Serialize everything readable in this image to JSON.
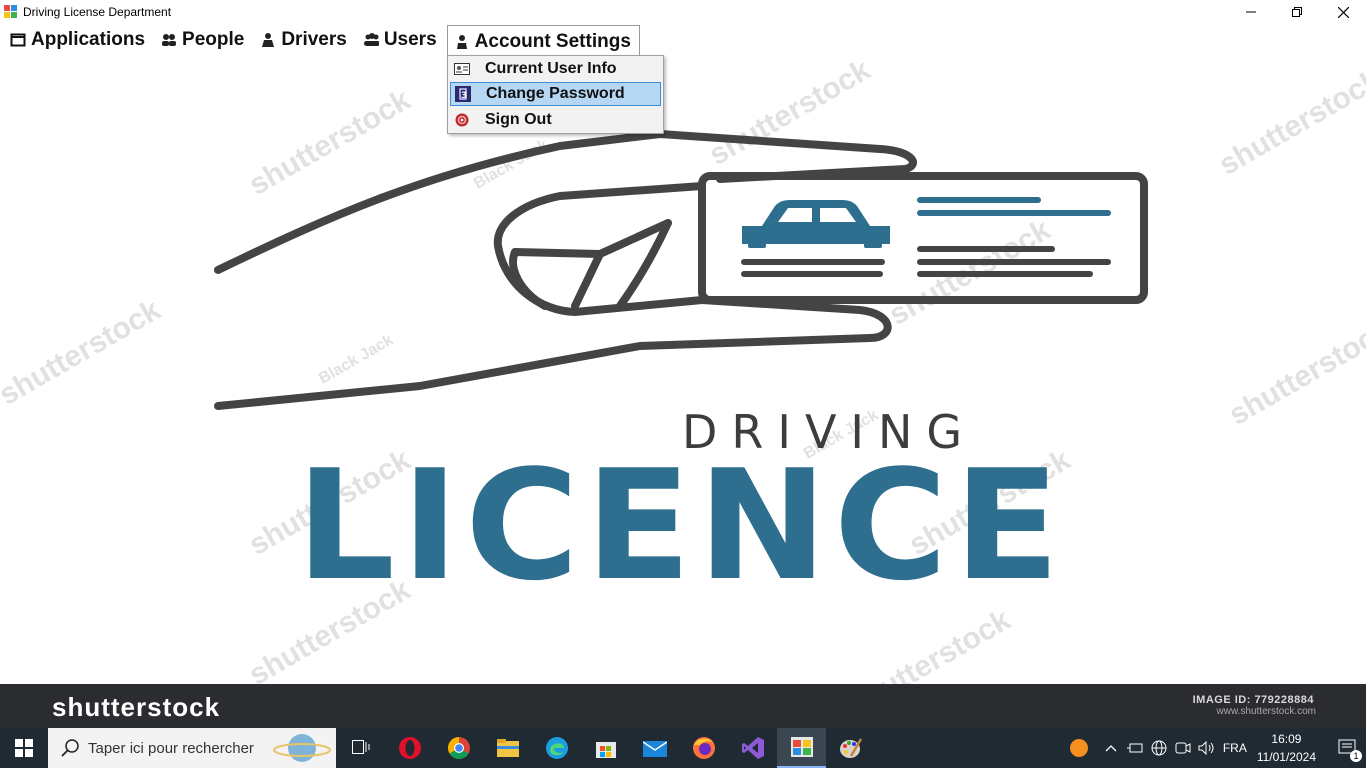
{
  "window": {
    "title": "Driving License Department"
  },
  "menubar": {
    "items": [
      {
        "label": "Applications",
        "icon": "window-icon"
      },
      {
        "label": "People",
        "icon": "people-icon"
      },
      {
        "label": "Drivers",
        "icon": "driver-icon"
      },
      {
        "label": "Users",
        "icon": "users-icon"
      },
      {
        "label": "Account Settings",
        "icon": "account-icon",
        "open": true
      }
    ]
  },
  "dropdown": {
    "items": [
      {
        "label": "Current User Info",
        "icon": "id-card-icon"
      },
      {
        "label": "Change Password",
        "icon": "password-icon",
        "highlighted": true
      },
      {
        "label": "Sign Out",
        "icon": "sign-out-icon"
      }
    ]
  },
  "background": {
    "heading_small": "DRIVING",
    "heading_large": "LICENCE",
    "accent_color": "#2e6e8e",
    "line_color": "#444444",
    "watermarks": [
      "shutterstock",
      "Black Jack"
    ]
  },
  "stockbar": {
    "brand": "shutterstock",
    "image_id": "IMAGE ID: 779228884",
    "url": "www.shutterstock.com"
  },
  "taskbar": {
    "search_placeholder": "Taper ici pour rechercher",
    "apps": [
      "task-view-icon",
      "opera-icon",
      "chrome-icon",
      "file-explorer-icon",
      "edge-icon",
      "store-icon",
      "mail-icon",
      "firefox-icon",
      "visual-studio-icon",
      "app-window-icon",
      "paint-icon"
    ],
    "language": "FRA",
    "time": "16:09",
    "date": "11/01/2024",
    "notifications": "1"
  }
}
